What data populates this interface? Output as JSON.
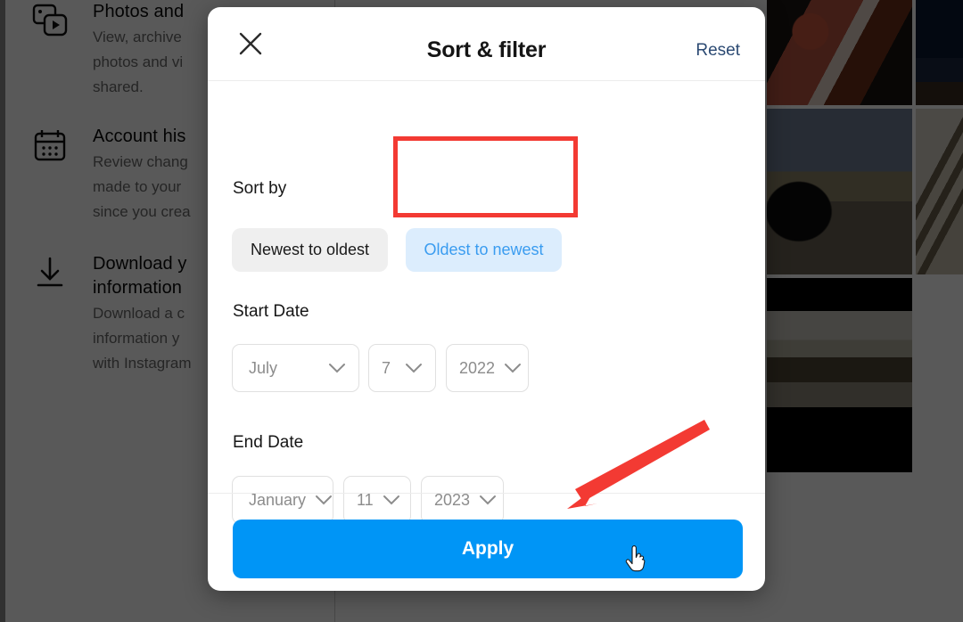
{
  "background": {
    "menu_items": [
      {
        "icon": "photos-videos-icon",
        "title": "Photos and",
        "desc_lines": [
          "View, archive",
          "photos and vi",
          "shared."
        ]
      },
      {
        "icon": "calendar-icon",
        "title": "Account his",
        "desc_lines": [
          "Review chang",
          "made to your",
          "since you crea"
        ]
      },
      {
        "icon": "download-icon",
        "title": "Download y",
        "title2": "information",
        "desc_lines": [
          "Download a c",
          "information y",
          "with Instagram"
        ]
      }
    ]
  },
  "modal": {
    "title": "Sort & filter",
    "close_icon": "close-x-icon",
    "reset_label": "Reset",
    "sort": {
      "label": "Sort by",
      "options": [
        {
          "label": "Newest to oldest",
          "selected": false
        },
        {
          "label": "Oldest to newest",
          "selected": true
        }
      ]
    },
    "start_date": {
      "label": "Start Date",
      "month": "July",
      "day": "7",
      "year": "2022"
    },
    "end_date": {
      "label": "End Date",
      "month": "January",
      "day": "11",
      "year": "2023"
    },
    "apply_label": "Apply"
  },
  "colors": {
    "accent_blue": "#0095F6",
    "selected_pill_bg": "#DCEDFD",
    "selected_pill_text": "#3A9CF0",
    "unselected_pill_bg": "#EFEFEF",
    "reset_link": "#2C4A73",
    "annotation_red": "#F33A33",
    "overlay": "#585858"
  },
  "annotations": {
    "highlight_box_target": "Oldest to newest",
    "arrow_target": "Apply",
    "cursor": "pointer-hand-cursor"
  }
}
